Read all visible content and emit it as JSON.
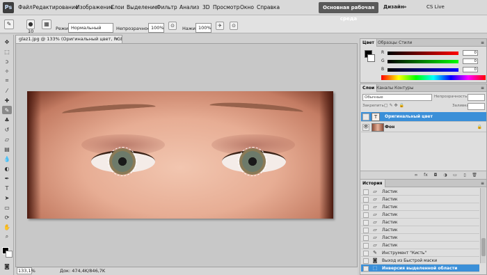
{
  "app": {
    "logo": "Ps"
  },
  "menu": [
    "Файл",
    "Редактирование",
    "Изображение",
    "Слои",
    "Выделение",
    "Фильтр",
    "Анализ",
    "3D",
    "Просмотр",
    "Окно",
    "Справка"
  ],
  "menubar": {
    "zoom": "133%",
    "workspace_active": "Основная рабочая среда",
    "workspace_design": "Дизайн",
    "workspace_more": "»",
    "cs_live": "CS Live"
  },
  "options": {
    "brush_size": "10",
    "mode_label": "Режим:",
    "mode_value": "Нормальный",
    "opacity_label": "Непрозрачность:",
    "opacity_value": "100%",
    "pressure_label": "Нажим:",
    "pressure_value": "100%"
  },
  "document": {
    "tab_title": "glaz1.jpg @ 133% (Оригинальный цвет, RGB/8#) *",
    "close": "×",
    "status_zoom": "133,1%",
    "status_doc": "Док: 474,4K/846,7K"
  },
  "color_panel": {
    "tabs": [
      "Цвет",
      "Образцы",
      "Стили"
    ],
    "r_label": "R",
    "r_value": "0",
    "g_label": "G",
    "g_value": "0",
    "b_label": "B",
    "b_value": "0"
  },
  "layers_panel": {
    "tabs": [
      "Слои",
      "Каналы",
      "Контуры"
    ],
    "blend_mode": "Обычные",
    "opacity_label": "Непрозрачность:",
    "lock_label": "Закрепить:",
    "fill_label": "Заливка:",
    "layers": [
      {
        "name": "Оригинальный цвет",
        "selected": true
      },
      {
        "name": "Фон",
        "selected": false
      }
    ]
  },
  "history_panel": {
    "tabs": [
      "История"
    ],
    "items": [
      {
        "name": "Ластик",
        "selected": false
      },
      {
        "name": "Ластик",
        "selected": false
      },
      {
        "name": "Ластик",
        "selected": false
      },
      {
        "name": "Ластик",
        "selected": false
      },
      {
        "name": "Ластик",
        "selected": false
      },
      {
        "name": "Ластик",
        "selected": false
      },
      {
        "name": "Ластик",
        "selected": false
      },
      {
        "name": "Ластик",
        "selected": false
      },
      {
        "name": "Инструмент \"Кисть\"",
        "selected": false
      },
      {
        "name": "Выход из Быстрой маски",
        "selected": false
      },
      {
        "name": "Инверсия выделенной области",
        "selected": true
      }
    ]
  },
  "colors": {
    "selection": "#3a8fd8",
    "workspace_button": "#5a5a5a"
  }
}
